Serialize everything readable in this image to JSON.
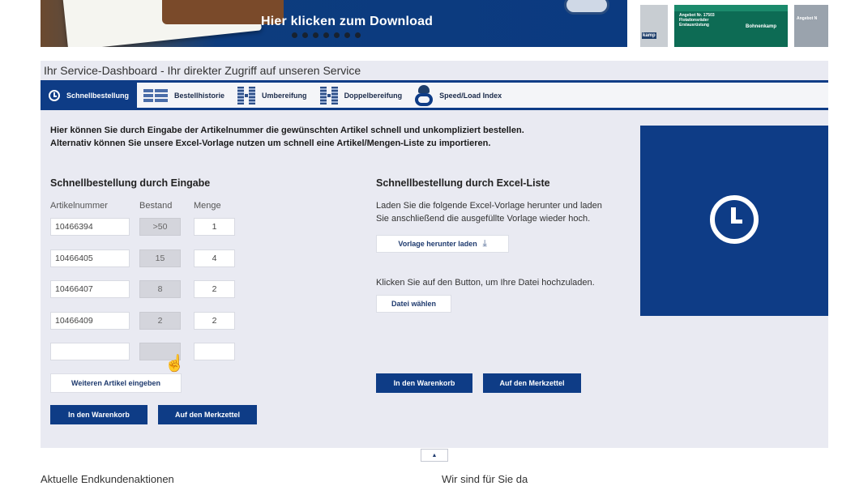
{
  "banner": {
    "cta": "Hier klicken zum Download"
  },
  "thumbs": {
    "t1_label": "kamp",
    "t2_line1": "Angebot Nr. 17503",
    "t2_line2": "Flotationsräder",
    "t2_line3": "Erstausrüstung",
    "t2_brand": "Bohnenkamp",
    "t3_line1": "Angebot N"
  },
  "dashboard": {
    "title": "Ihr Service-Dashboard - Ihr direkter Zugriff auf unseren Service",
    "tabs": [
      {
        "label": "Schnellbestellung",
        "icon": "clock-icon",
        "active": true
      },
      {
        "label": "Bestellhistorie",
        "icon": "list-icon"
      },
      {
        "label": "Umbereifung",
        "icon": "tire-icon"
      },
      {
        "label": "Doppelbereifung",
        "icon": "double-tire-icon"
      },
      {
        "label": "Speed/Load Index",
        "icon": "gauge-icon"
      }
    ],
    "intro_line1": "Hier können Sie durch Eingabe der Artikelnummer die gewünschten Artikel schnell und unkompliziert bestellen.",
    "intro_line2": "Alternativ können Sie unsere Excel-Vorlage nutzen um schnell eine Artikel/Mengen-Liste zu importieren."
  },
  "manual": {
    "heading": "Schnellbestellung durch Eingabe",
    "col_article": "Artikelnummer",
    "col_stock": "Bestand",
    "col_qty": "Menge",
    "rows": [
      {
        "article": "10466394",
        "stock": ">50",
        "qty": "1"
      },
      {
        "article": "10466405",
        "stock": "15",
        "qty": "4"
      },
      {
        "article": "10466407",
        "stock": "8",
        "qty": "2"
      },
      {
        "article": "10466409",
        "stock": "2",
        "qty": "2"
      },
      {
        "article": "",
        "stock": "",
        "qty": ""
      }
    ],
    "add_more": "Weiteren Artikel eingeben",
    "to_cart": "In den Warenkorb",
    "to_watchlist": "Auf den Merkzettel"
  },
  "excel": {
    "heading": "Schnellbestellung durch Excel-Liste",
    "text1_line1": "Laden Sie die folgende Excel-Vorlage herunter und laden",
    "text1_line2": "Sie anschließend die ausgefüllte Vorlage wieder hoch.",
    "download": "Vorlage herunter laden",
    "text2": "Klicken Sie auf den Button, um Ihre Datei hochzuladen.",
    "choose_file": "Datei wählen",
    "to_cart": "In den Warenkorb",
    "to_watchlist": "Auf den Merkzettel"
  },
  "footer": {
    "left": "Aktuelle Endkundenaktionen",
    "right": "Wir sind für Sie da"
  }
}
